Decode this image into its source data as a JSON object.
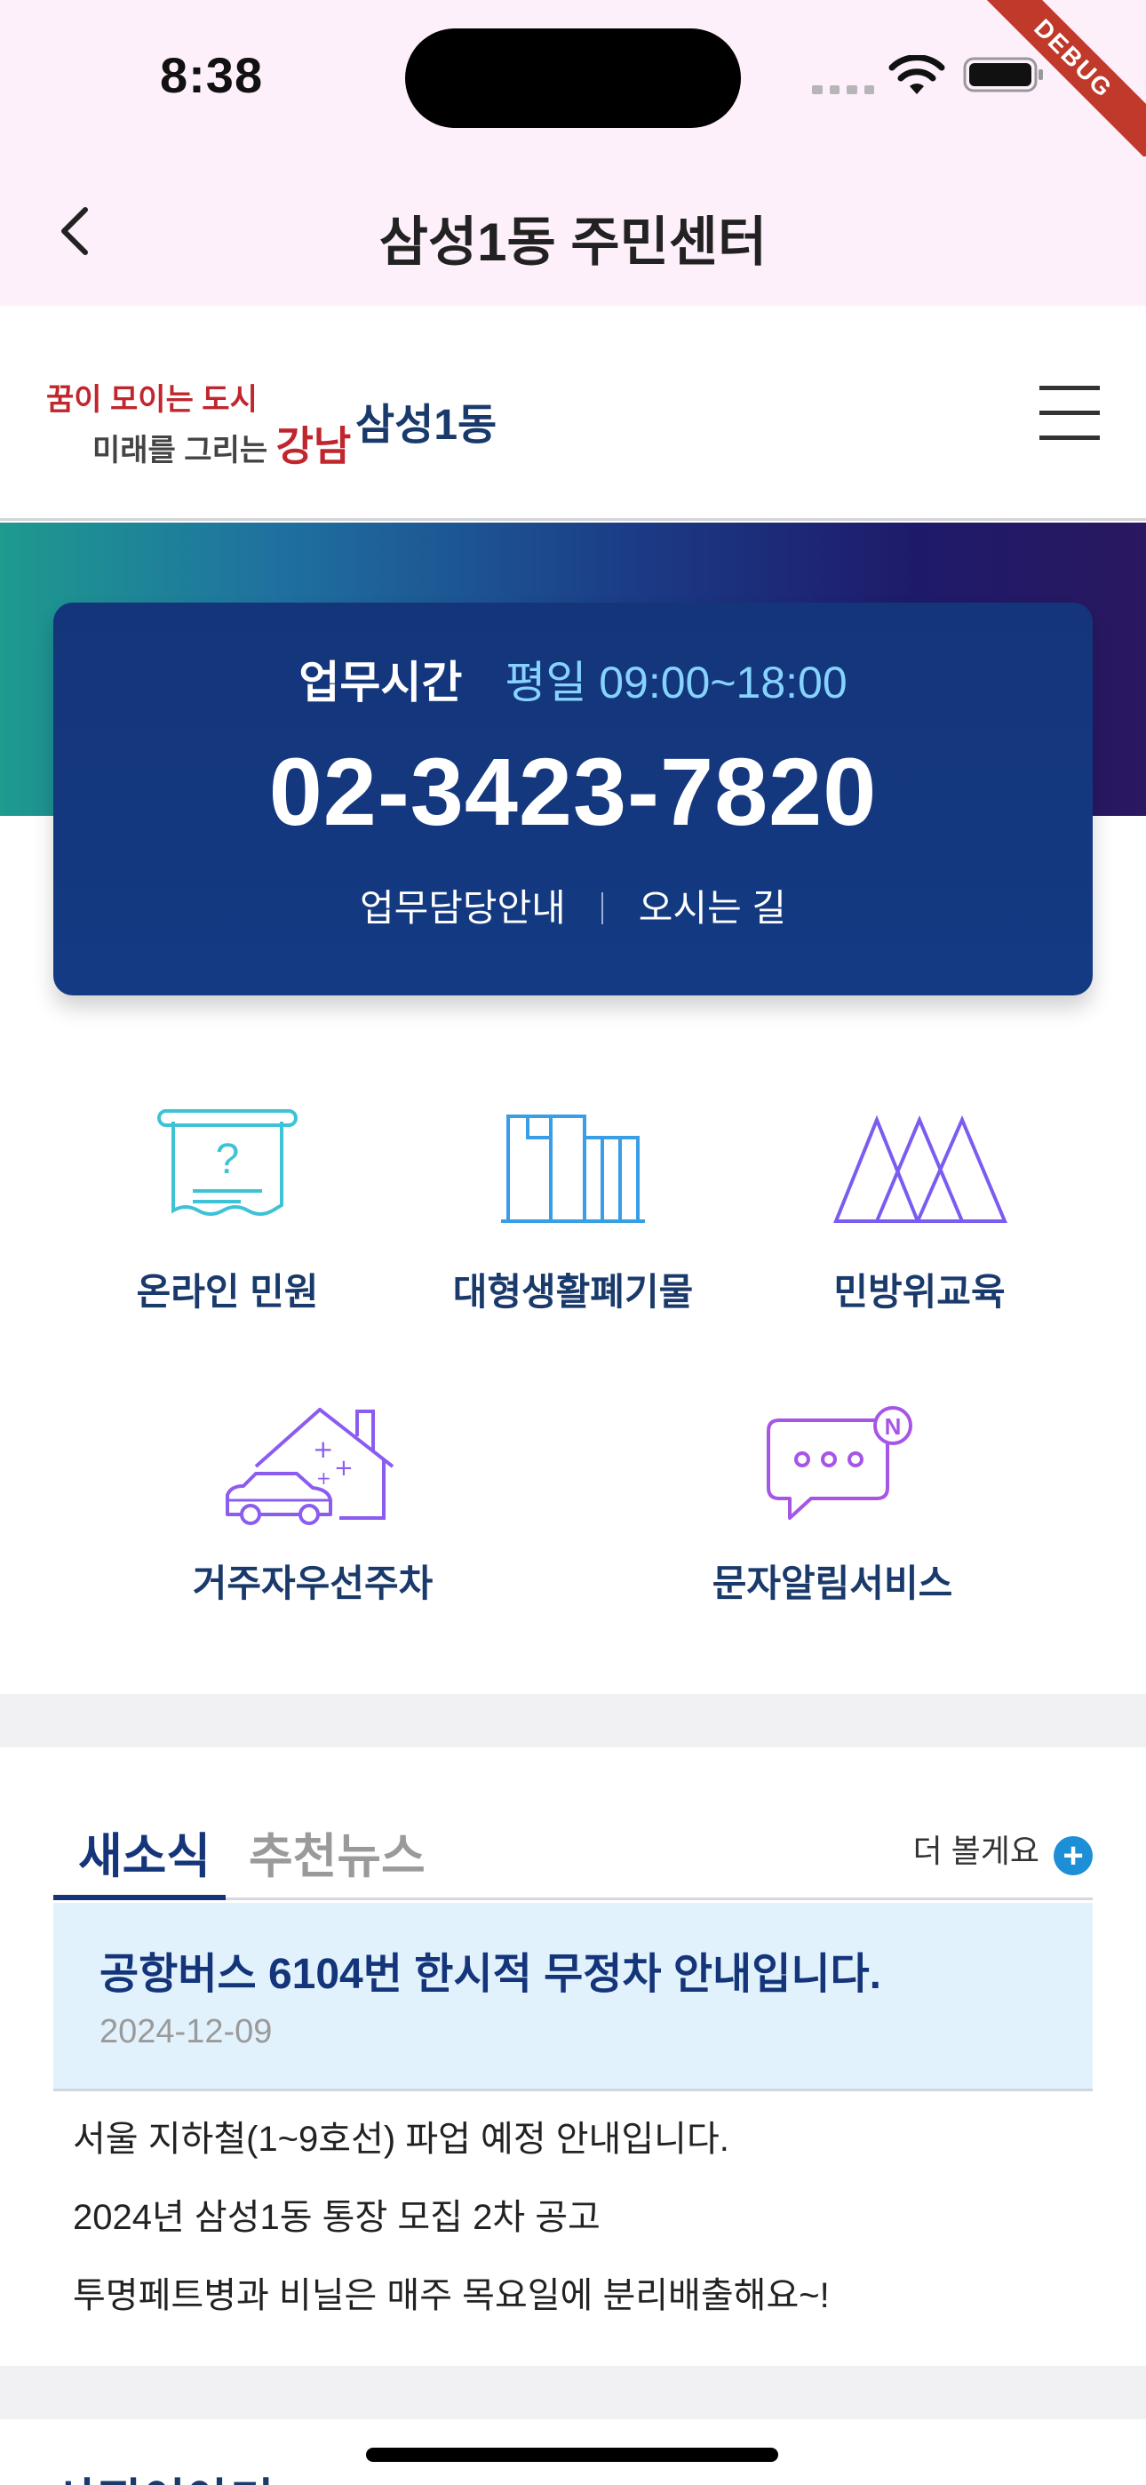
{
  "status_bar": {
    "time": "8:38",
    "debug_label": "DEBUG"
  },
  "app_bar": {
    "title": "삼성1동 주민센터"
  },
  "header": {
    "logo_line1": "꿈이 모이는 도시",
    "logo_line2_prefix": "미래를 그리는 ",
    "logo_line2_brand": "강남",
    "district": "삼성1동"
  },
  "info_card": {
    "hours_label": "업무시간",
    "hours_value": "평일 09:00~18:00",
    "phone": "02-3423-7820",
    "link_staff": "업무담당안내",
    "link_directions": "오시는 길"
  },
  "services": [
    {
      "label": "온라인 민원",
      "icon": "receipt-question-icon"
    },
    {
      "label": "대형생활폐기물",
      "icon": "furniture-waste-icon"
    },
    {
      "label": "민방위교육",
      "icon": "triangles-icon"
    },
    {
      "label": "거주자우선주차",
      "icon": "house-car-icon"
    },
    {
      "label": "문자알림서비스",
      "icon": "chat-notification-icon"
    }
  ],
  "news": {
    "tabs": [
      "새소식",
      "추천뉴스"
    ],
    "more_label": "더 볼게요",
    "featured": {
      "title": "공항버스 6104번 한시적 무정차 안내입니다.",
      "date": "2024-12-09"
    },
    "items": [
      "서울 지하철(1~9호선) 파업 예정 안내입니다.",
      "2024년 삼성1동 통장 모집 2차 공고",
      "투명페트병과 비닐은 매주 목요일에 분리배출해요~!"
    ]
  },
  "bottom_section": {
    "heading": "사진이야기"
  },
  "colors": {
    "accent": "#14357a",
    "status_bar_bg": "#fdf0fb",
    "highlight": "#86d3ff"
  }
}
